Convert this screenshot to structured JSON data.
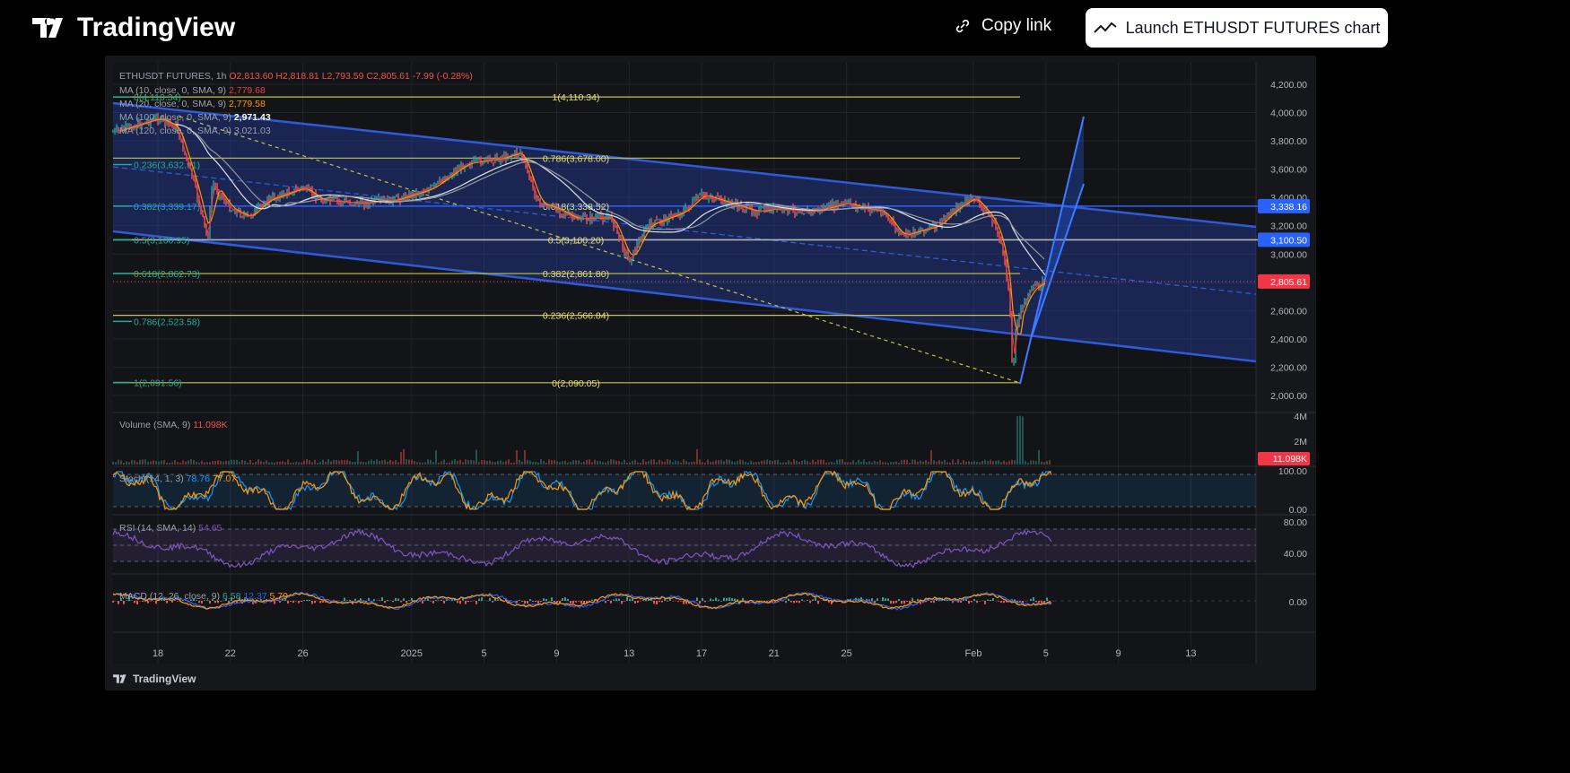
{
  "header": {
    "logo": "TradingView",
    "copy_link": "Copy link",
    "launch_button": "Launch ETHUSDT FUTURES chart"
  },
  "legend": {
    "symbol": "ETHUSDT FUTURES, 1h",
    "open": "O2,813.60",
    "high": "H2,818.81",
    "low": "L2,793.59",
    "close": "C2,805.61",
    "change": "-7.99 (-0.28%)",
    "ma": [
      {
        "label": "MA (10, close, 0, SMA, 9)",
        "value": "2,779.68",
        "color": "#f23645"
      },
      {
        "label": "MA (20, close, 0, SMA, 9)",
        "value": "2,779.58",
        "color": "#ff9800"
      },
      {
        "label": "MA (100, close, 0, SMA, 9)",
        "value": "2,971.43",
        "color": "#ffffff"
      },
      {
        "label": "MA (120, close, 0, SMA, 9)",
        "value": "3,021.03",
        "color": "#9aa0ac"
      }
    ],
    "volume": {
      "label": "Volume (SMA, 9)",
      "value": "11.098K"
    },
    "stoch": {
      "label": "Stoch (14, 1, 3)",
      "k": "78.76",
      "d": "77.07"
    },
    "rsi": {
      "label": "RSI (14, SMA, 14)",
      "value": "54.65"
    },
    "macd": {
      "label": "MACD (12, 26, close, 9)",
      "hist": "6.58",
      "macd": "12.37",
      "signal": "5.79"
    }
  },
  "colors": {
    "up": "#26a69a",
    "down": "#ef5350",
    "channel": "#2f5bd8",
    "fib": "#c8c24a",
    "fib_left": "#22ab94",
    "rsi": "#7e57c2"
  },
  "chart_data": {
    "type": "line",
    "symbol": "ETHUSDT FUTURES",
    "interval": "1h",
    "x_ticks": [
      "18",
      "22",
      "26",
      "2025",
      "5",
      "9",
      "13",
      "17",
      "21",
      "25",
      "Feb",
      "5",
      "9",
      "13"
    ],
    "x_tick_dates": [
      "2024-12-18",
      "2024-12-22",
      "2024-12-26",
      "2025-01-01",
      "2025-01-05",
      "2025-01-09",
      "2025-01-13",
      "2025-01-17",
      "2025-01-21",
      "2025-01-25",
      "2025-02-01",
      "2025-02-05",
      "2025-02-09",
      "2025-02-13"
    ],
    "y_ticks": [
      "4,200.00",
      "4,000.00",
      "3,800.00",
      "3,600.00",
      "3,400.00",
      "3,200.00",
      "3,000.00",
      "2,800.00",
      "2,600.00",
      "2,400.00",
      "2,200.00",
      "2,000.00"
    ],
    "ylim": [
      2000,
      4200
    ],
    "price_badges": [
      {
        "value": "3,338.16",
        "color": "#2962ff"
      },
      {
        "value": "3,100.50",
        "color": "#2962ff"
      },
      {
        "value": "2,805.61",
        "color": "#f23645"
      }
    ],
    "series": [
      {
        "values": [
          [
            "2024-12-16",
            3880
          ],
          [
            "2024-12-18",
            3960
          ],
          [
            "2024-12-19",
            3900
          ],
          [
            "2024-12-20",
            3500
          ],
          [
            "2024-12-20T18",
            3100
          ],
          [
            "2024-12-21",
            3500
          ],
          [
            "2024-12-22",
            3320
          ],
          [
            "2024-12-23",
            3260
          ],
          [
            "2024-12-24",
            3380
          ],
          [
            "2024-12-26",
            3470
          ],
          [
            "2024-12-27",
            3380
          ],
          [
            "2024-12-29",
            3360
          ],
          [
            "2024-12-31",
            3380
          ],
          [
            "2025-01-02",
            3460
          ],
          [
            "2025-01-04",
            3640
          ],
          [
            "2025-01-06",
            3680
          ],
          [
            "2025-01-07",
            3720
          ],
          [
            "2025-01-08",
            3360
          ],
          [
            "2025-01-09",
            3320
          ],
          [
            "2025-01-10",
            3250
          ],
          [
            "2025-01-12",
            3260
          ],
          [
            "2025-01-13",
            2950
          ],
          [
            "2025-01-14",
            3200
          ],
          [
            "2025-01-16",
            3300
          ],
          [
            "2025-01-17",
            3420
          ],
          [
            "2025-01-18",
            3380
          ],
          [
            "2025-01-20",
            3300
          ],
          [
            "2025-01-21",
            3320
          ],
          [
            "2025-01-23",
            3300
          ],
          [
            "2025-01-25",
            3360
          ],
          [
            "2025-01-26",
            3320
          ],
          [
            "2025-01-27",
            3300
          ],
          [
            "2025-01-28",
            3130
          ],
          [
            "2025-01-30",
            3200
          ],
          [
            "2025-01-31",
            3320
          ],
          [
            "2025-02-01",
            3400
          ],
          [
            "2025-02-02",
            3250
          ],
          [
            "2025-02-02T12",
            3100
          ],
          [
            "2025-02-03",
            2700
          ],
          [
            "2025-02-03T04",
            2090
          ],
          [
            "2025-02-03T08",
            2500
          ],
          [
            "2025-02-04",
            2720
          ],
          [
            "2025-02-04T12",
            2780
          ],
          [
            "2025-02-05",
            2805.61
          ]
        ]
      }
    ],
    "fib_right": [
      {
        "label": "1(4,110.34)",
        "price": 4110.34
      },
      {
        "label": "0.786(3,678.00)",
        "price": 3678
      },
      {
        "label": "0.618(3,338.52)",
        "price": 3338.52
      },
      {
        "label": "0.5(3,100.20)",
        "price": 3100.2
      },
      {
        "label": "0.382(2,861.80)",
        "price": 2861.8
      },
      {
        "label": "0.236(2,566.84)",
        "price": 2566.84
      },
      {
        "label": "0(2,090.05)",
        "price": 2090.05
      }
    ],
    "fib_left": [
      {
        "label": "0(4,110.34)",
        "price": 4110.34
      },
      {
        "label": "0.236(3,632.91)",
        "price": 3632.91
      },
      {
        "label": "0.382(3,339.17)",
        "price": 3339.17
      },
      {
        "label": "0.5(3,100.95)",
        "price": 3100.95
      },
      {
        "label": "0.618(2,862.73)",
        "price": 2862.73
      },
      {
        "label": "0.786(2,523.58)",
        "price": 2523.58
      },
      {
        "label": "1(2,091.56)",
        "price": 2091.56
      }
    ],
    "volume_ticks": [
      "4M",
      "2M"
    ],
    "volume_badge": "11.098K",
    "stoch_ticks": [
      "100.00",
      "0.00"
    ],
    "rsi_ticks": [
      "80.00",
      "40.00"
    ],
    "macd_ticks": [
      "0.00"
    ]
  },
  "footer": {
    "brand": "TradingView"
  }
}
